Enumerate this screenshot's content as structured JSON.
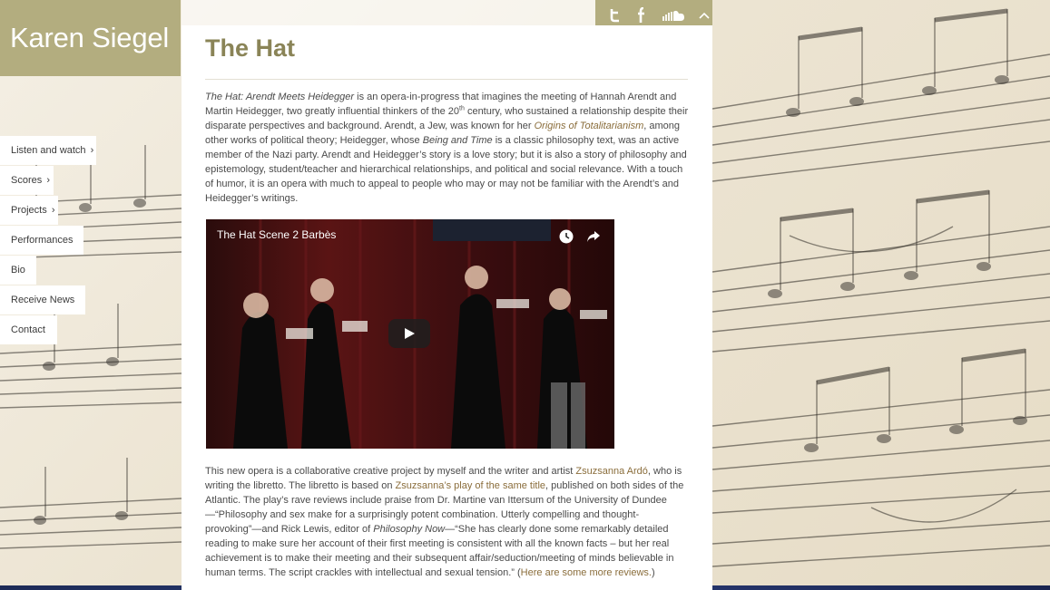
{
  "site": {
    "title": "Karen Siegel"
  },
  "nav": {
    "items": [
      {
        "label": "Listen and watch",
        "chevron": "›"
      },
      {
        "label": "Scores",
        "chevron": "›"
      },
      {
        "label": "Projects",
        "chevron": "›"
      },
      {
        "label": "Performances"
      },
      {
        "label": "Bio"
      },
      {
        "label": "Receive News"
      },
      {
        "label": "Contact"
      }
    ]
  },
  "social": {
    "icons": [
      "twitter-icon",
      "facebook-icon",
      "soundcloud-icon",
      "scroll-up-icon"
    ]
  },
  "page": {
    "title": "The Hat",
    "p1": {
      "s1_em": "The Hat: Arendt Meets Heidegger",
      "s2": " is an opera-in-progress that imagines the meeting of Hannah Arendt and Martin Heidegger, two greatly influential thinkers of the 20",
      "s2_sup": "th",
      "s3": " century, who sustained a relationship despite their disparate perspectives and background. Arendt, a Jew, was known for her ",
      "s4_link": "Origins of Totalitarianism",
      "s5": ", among other works of political theory; Heidegger, whose ",
      "s6_em": "Being and Time",
      "s7": " is a classic philosophy text, was an active member of the Nazi party.  Arendt and Heidegger’s story is a love story; but it is also a story of philosophy and epistemology, student/teacher and hierarchical relationships, and political and social relevance.  With a touch of humor, it is an opera with much to appeal to people who may or may not be familiar with the Arendt’s and Heidegger’s writings."
    },
    "video": {
      "title": "The Hat Scene 2 Barbès",
      "icons": [
        "clock-icon",
        "share-icon",
        "play-icon"
      ]
    },
    "p2": {
      "s1": "This new opera is a collaborative creative project by myself and the writer and artist ",
      "s2_link": "Zsuzsanna Ardó",
      "s3": ", who is writing the libretto.  The libretto is based on ",
      "s4_link": "Zsuzsanna’s play of the same title",
      "s5": ", published on both sides of the Atlantic.  The play’s rave reviews include praise from Dr. Martine van Ittersum of the University of Dundee—“Philosophy and sex make for a surprisingly potent combination. Utterly compelling and thought-provoking”—and Rick Lewis, editor of ",
      "s6_em": "Philosophy Now",
      "s7": "—“She has clearly done some remarkably detailed reading to make sure her account of their first meeting is consistent with all the known facts – but her real achievement is to make their meeting and their subsequent affair/seduction/meeting of minds believable in human terms. The script crackles with intellectual and sexual tension.”  (",
      "s8_link": "Here are some more reviews.",
      "s9": ")"
    }
  },
  "colors": {
    "accent": "#b3ad7f",
    "title": "#8a8457",
    "link": "#8a6d3b",
    "text": "#4a4a4a"
  }
}
